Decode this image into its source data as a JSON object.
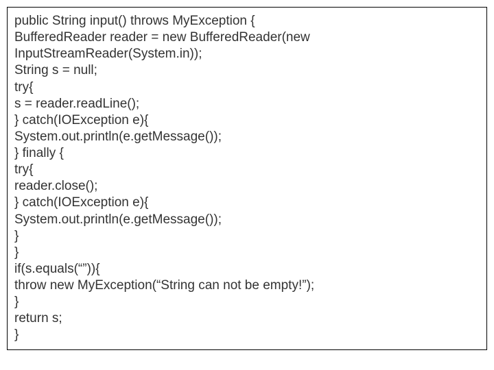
{
  "code": {
    "lines": [
      "public String input() throws MyException {",
      "BufferedReader reader = new BufferedReader(new InputStreamReader(System.in));",
      "String s = null;",
      "try{",
      "s = reader.readLine();",
      "} catch(IOException e){",
      "System.out.println(e.getMessage());",
      "} finally {",
      "try{",
      "reader.close();",
      "} catch(IOException e){",
      "System.out.println(e.getMessage());",
      "}",
      "}",
      "if(s.equals(“”)){",
      "throw new MyException(“String can not be empty!”);",
      "}",
      "return s;",
      "}"
    ]
  }
}
